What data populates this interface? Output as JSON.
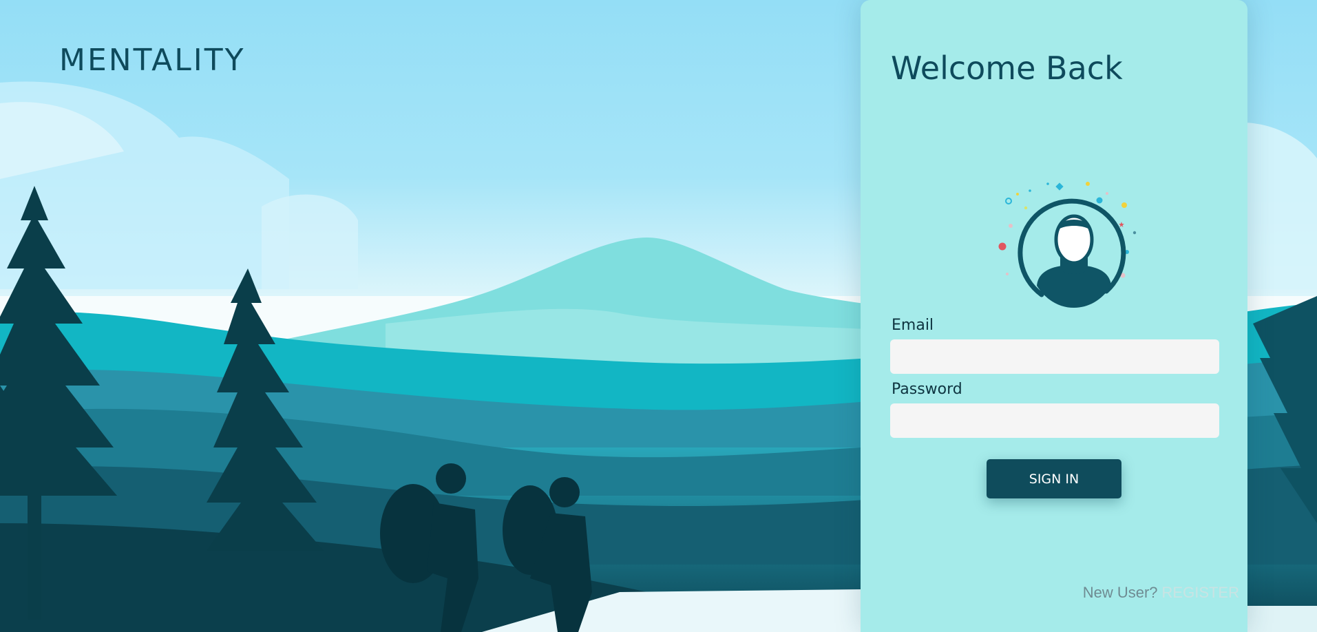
{
  "brand": {
    "name": "MENTALITY"
  },
  "login": {
    "title": "Welcome Back",
    "email": {
      "label": "Email",
      "value": "",
      "placeholder": ""
    },
    "password": {
      "label": "Password",
      "value": "",
      "placeholder": ""
    },
    "submit_label": "SIGN IN",
    "footer": {
      "prompt": "New User?",
      "link_label": "REGISTER"
    }
  },
  "colors": {
    "brand_dark": "#0e4a5c",
    "card_bg": "#a5ebea",
    "button_bg": "#0f4c5c",
    "input_bg": "#f5f5f5"
  },
  "icons": {
    "avatar": "user-avatar-icon"
  }
}
